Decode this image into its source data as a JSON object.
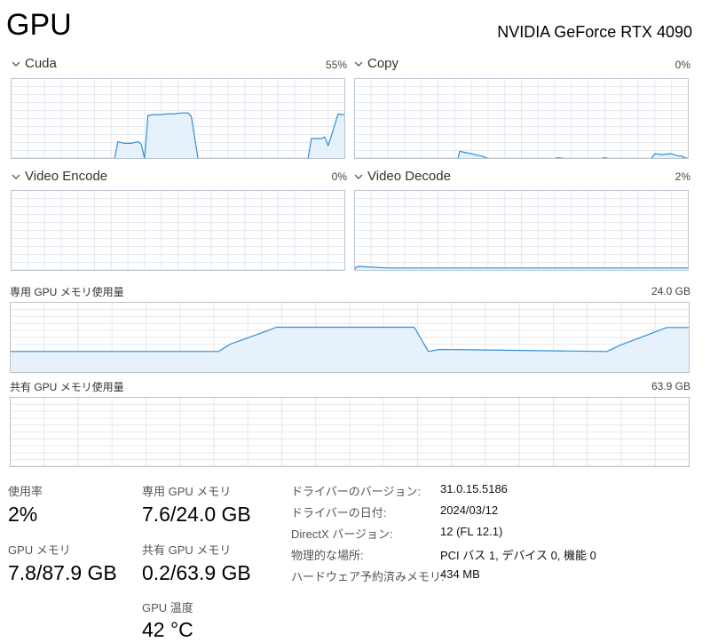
{
  "header": {
    "title": "GPU",
    "device_name": "NVIDIA GeForce RTX 4090"
  },
  "colors": {
    "line": "#2f8fd6",
    "fill": "#e7f1fb",
    "grid": "#e3e9ef",
    "border": "#b9c4cf"
  },
  "engines": [
    {
      "id": "cuda",
      "label": "Cuda",
      "percent": "55%",
      "series": [
        [
          0,
          0
        ],
        [
          31,
          0
        ],
        [
          32,
          21
        ],
        [
          34,
          19
        ],
        [
          36,
          19
        ],
        [
          38,
          21
        ],
        [
          39,
          18
        ],
        [
          40,
          0
        ],
        [
          41,
          54
        ],
        [
          43,
          55
        ],
        [
          45,
          55
        ],
        [
          47,
          56
        ],
        [
          49,
          56
        ],
        [
          51,
          57
        ],
        [
          53,
          57
        ],
        [
          54,
          53
        ],
        [
          56,
          0
        ],
        [
          89,
          0
        ],
        [
          90,
          25
        ],
        [
          93,
          25
        ],
        [
          94,
          27
        ],
        [
          95,
          16
        ],
        [
          96,
          29
        ],
        [
          98,
          56
        ],
        [
          99,
          55
        ],
        [
          100,
          55
        ]
      ]
    },
    {
      "id": "copy",
      "label": "Copy",
      "percent": "0%",
      "series": [
        [
          0,
          0
        ],
        [
          31,
          0
        ],
        [
          31.5,
          9
        ],
        [
          35,
          6
        ],
        [
          37,
          4
        ],
        [
          38,
          3
        ],
        [
          40,
          0
        ],
        [
          60,
          0
        ],
        [
          61,
          1
        ],
        [
          63,
          0
        ],
        [
          74,
          0
        ],
        [
          75,
          1
        ],
        [
          76,
          0
        ],
        [
          89,
          0
        ],
        [
          90,
          6
        ],
        [
          92,
          5
        ],
        [
          95,
          6
        ],
        [
          97,
          3
        ],
        [
          98,
          3
        ],
        [
          99,
          1
        ],
        [
          100,
          0
        ]
      ]
    },
    {
      "id": "video-encode",
      "label": "Video Encode",
      "percent": "0%",
      "series": [
        [
          0,
          0
        ],
        [
          100,
          0
        ]
      ]
    },
    {
      "id": "video-decode",
      "label": "Video Decode",
      "percent": "2%",
      "series": [
        [
          0,
          1
        ],
        [
          0.5,
          4
        ],
        [
          1,
          5
        ],
        [
          10,
          3
        ],
        [
          30,
          3
        ],
        [
          60,
          3
        ],
        [
          90,
          3
        ],
        [
          100,
          3
        ]
      ]
    }
  ],
  "memory": [
    {
      "id": "dedicated",
      "label": "専用 GPU メモリ使用量",
      "max_value": "24.0 GB",
      "series": [
        [
          0,
          7.2
        ],
        [
          30.7,
          7.2
        ],
        [
          32.4,
          9.7
        ],
        [
          37.9,
          14.3
        ],
        [
          39.2,
          15.5
        ],
        [
          59.5,
          15.5
        ],
        [
          61.6,
          7.2
        ],
        [
          63.2,
          7.9
        ],
        [
          87.9,
          7.2
        ],
        [
          89.9,
          9.4
        ],
        [
          96.7,
          15.4
        ],
        [
          100,
          15.4
        ]
      ]
    },
    {
      "id": "shared",
      "label": "共有 GPU メモリ使用量",
      "max_value": "63.9 GB",
      "series": [
        [
          0,
          0
        ],
        [
          100,
          0
        ]
      ]
    }
  ],
  "stats": {
    "utilization": {
      "label": "使用率",
      "value": "2%"
    },
    "dedicated_memory": {
      "label": "専用 GPU メモリ",
      "value": "7.6/24.0 GB"
    },
    "gpu_memory": {
      "label": "GPU メモリ",
      "value": "7.8/87.9 GB"
    },
    "shared_memory": {
      "label": "共有 GPU メモリ",
      "value": "0.2/63.9 GB"
    },
    "temperature": {
      "label": "GPU 温度",
      "value": "42 °C"
    }
  },
  "info": [
    {
      "key": "ドライバーのバージョン:",
      "value": "31.0.15.5186"
    },
    {
      "key": "ドライバーの日付:",
      "value": "2024/03/12"
    },
    {
      "key": "DirectX バージョン:",
      "value": "12 (FL 12.1)"
    },
    {
      "key": "物理的な場所:",
      "value": "PCI バス 1, デバイス 0, 機能 0"
    },
    {
      "key": "ハードウェア予約済みメモリ:",
      "value": "434 MB"
    }
  ]
}
